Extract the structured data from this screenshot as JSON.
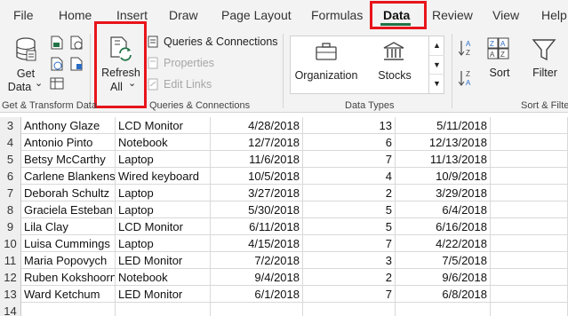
{
  "tabs": [
    "File",
    "Home",
    "Insert",
    "Draw",
    "Page Layout",
    "Formulas",
    "Data",
    "Review",
    "View",
    "Help"
  ],
  "ribbon": {
    "get_data": {
      "line1": "Get",
      "line2": "Data",
      "caret": "⌄"
    },
    "refresh_all": {
      "line1": "Refresh",
      "line2": "All",
      "caret": "⌄"
    },
    "queries_connections": "Queries & Connections",
    "properties": "Properties",
    "edit_links": "Edit Links",
    "data_types": {
      "organization": "Organization",
      "stocks": "Stocks"
    },
    "sort": "Sort",
    "filter": "Filter",
    "groups": {
      "get_transform": "Get & Transform Data",
      "queries": "Queries & Connections",
      "data_types": "Data Types",
      "sort_filter": "Sort & Filte"
    }
  },
  "highlight_color": "#e8141b",
  "accent_color": "#217346",
  "rows": [
    {
      "row": "3",
      "name": "Anthony Glaze",
      "product": "LCD Monitor",
      "date": "4/28/2018",
      "qty": "13",
      "ship": "5/11/2018"
    },
    {
      "row": "4",
      "name": "Antonio Pinto",
      "product": "Notebook",
      "date": "12/7/2018",
      "qty": "6",
      "ship": "12/13/2018"
    },
    {
      "row": "5",
      "name": "Betsy McCarthy",
      "product": "Laptop",
      "date": "11/6/2018",
      "qty": "7",
      "ship": "11/13/2018"
    },
    {
      "row": "6",
      "name": "Carlene Blankenship",
      "product": "Wired keyboard",
      "date": "10/5/2018",
      "qty": "4",
      "ship": "10/9/2018"
    },
    {
      "row": "7",
      "name": "Deborah Schultz",
      "product": "Laptop",
      "date": "3/27/2018",
      "qty": "2",
      "ship": "3/29/2018"
    },
    {
      "row": "8",
      "name": "Graciela Esteban",
      "product": "Laptop",
      "date": "5/30/2018",
      "qty": "5",
      "ship": "6/4/2018"
    },
    {
      "row": "9",
      "name": "Lila Clay",
      "product": "LCD Monitor",
      "date": "6/11/2018",
      "qty": "5",
      "ship": "6/16/2018"
    },
    {
      "row": "10",
      "name": "Luisa Cummings",
      "product": "Laptop",
      "date": "4/15/2018",
      "qty": "7",
      "ship": "4/22/2018"
    },
    {
      "row": "11",
      "name": "Maria Popovych",
      "product": "LED Monitor",
      "date": "7/2/2018",
      "qty": "3",
      "ship": "7/5/2018"
    },
    {
      "row": "12",
      "name": "Ruben Kokshoorn",
      "product": "Notebook",
      "date": "9/4/2018",
      "qty": "2",
      "ship": "9/6/2018"
    },
    {
      "row": "13",
      "name": "Ward Ketchum",
      "product": "LED Monitor",
      "date": "6/1/2018",
      "qty": "7",
      "ship": "6/8/2018"
    },
    {
      "row": "14",
      "name": "",
      "product": "",
      "date": "",
      "qty": "",
      "ship": ""
    }
  ]
}
